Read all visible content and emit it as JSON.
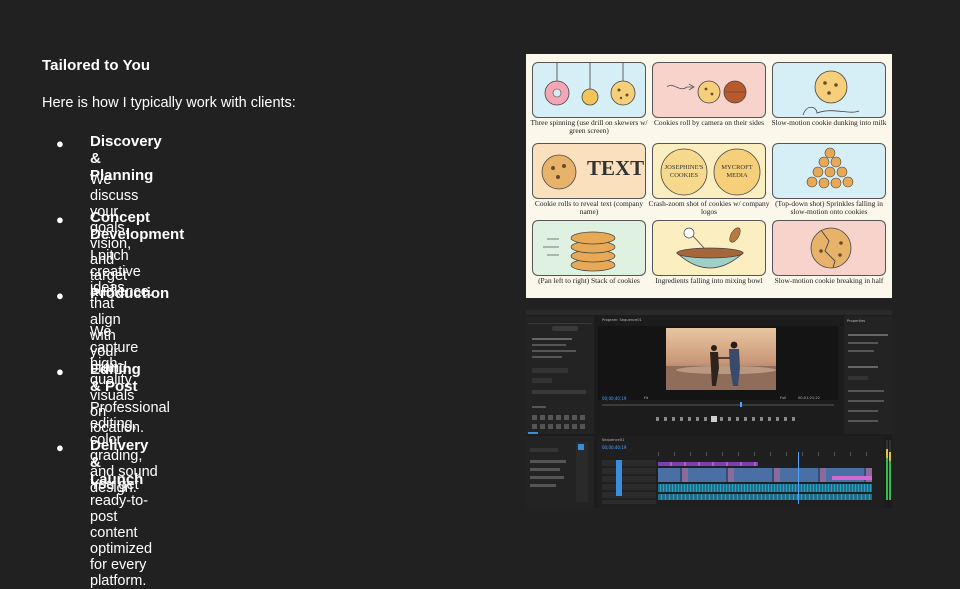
{
  "slide": {
    "heading": "Tailored to You",
    "intro": "Here is how I typically work with clients:",
    "bullet_glyph": "●",
    "steps": [
      {
        "title": "Discovery & Planning",
        "description": "We discuss your goals, vision, and target audience."
      },
      {
        "title": "Concept Development",
        "description": "I pitch creative ideas that align with your brand."
      },
      {
        "title": "Production",
        "description": "We capture high-quality visuals on location."
      },
      {
        "title": "Editing & Post",
        "description": "Professional editing, color grading, and sound design."
      },
      {
        "title": "Delivery & Launch",
        "description": "You get ready-to-post content optimized for every platform."
      }
    ]
  },
  "storyboard": {
    "panels": [
      {
        "caption": "Three spinning (use drill on skewers w/ green screen)",
        "color": "#d6eef6"
      },
      {
        "caption": "Cookies roll by camera on their sides",
        "color": "#f7d3cc"
      },
      {
        "caption": "Slow-motion cookie dunking into milk",
        "color": "#d6eef6"
      },
      {
        "caption": "Cookie rolls to reveal text (company name)",
        "color": "#fbe0bd"
      },
      {
        "caption": "Crash-zoom shot of cookies w/ company logos",
        "color": "#fbeec0"
      },
      {
        "caption": "(Top-down shot) Sprinkles falling in slow-motion onto cookies",
        "color": "#d6eef6"
      },
      {
        "caption": "(Pan left to right) Stack of cookies",
        "color": "#dff1e0"
      },
      {
        "caption": "Ingredients falling into mixing bowl",
        "color": "#fbeec0"
      },
      {
        "caption": "Slow-motion cookie breaking in half",
        "color": "#f7d3cc"
      }
    ],
    "text_panel_word": "TEXT",
    "logo_left": [
      "JOSEPHINE'S",
      "COOKIES"
    ],
    "logo_right": [
      "MYCROFT",
      "MEDIA"
    ]
  },
  "editor": {
    "program_title": "Program: Sequence01",
    "properties_title": "Properties",
    "timeline_title": "Sequence01",
    "timecode_left": "00;00;40;19",
    "timecode_right": "00;01;21;22",
    "timeline_timecode": "00;00;40;19",
    "fit_label": "Fit",
    "full_label": "Full",
    "accent_blue": "#3a8ddd",
    "panel_bg": "#1c1c1c"
  }
}
